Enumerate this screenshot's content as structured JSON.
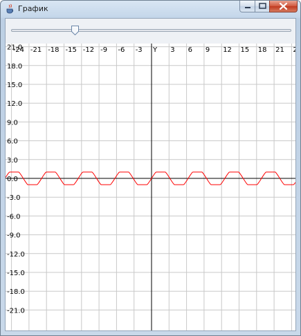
{
  "window": {
    "title": "График"
  },
  "slider": {
    "value_fraction": 0.22
  },
  "graph": {
    "x_ticks": [
      "-24",
      "-21",
      "-18",
      "-15",
      "-12",
      "-9",
      "-6",
      "-3",
      "Y",
      "3",
      "6",
      "9",
      "12",
      "15",
      "18",
      "21",
      "2"
    ],
    "y_ticks": [
      "21.0",
      "18.0",
      "15.0",
      "12.0",
      "9.0",
      "6.0",
      "3.0",
      "0.0",
      "-3.0",
      "-6.0",
      "-9.0",
      "-12.0",
      "-15.0",
      "-18.0",
      "-21.0"
    ],
    "x_axis_name": "Y",
    "curve_color": "#ff0000",
    "axis_color": "#000000",
    "grid_color": "#c8c8c8"
  },
  "chart_data": {
    "type": "line",
    "x_range": [
      -25,
      25
    ],
    "y_range": [
      -23,
      22
    ],
    "grid": true,
    "series": [
      {
        "function": "sin(x) with flattened peaks",
        "amplitude": 1.0,
        "period": 6.28
      }
    ]
  }
}
